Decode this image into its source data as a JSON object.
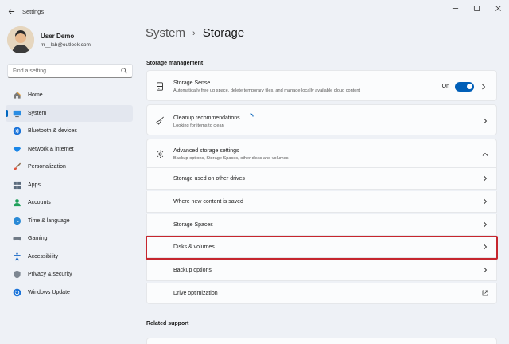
{
  "window": {
    "title": "Settings"
  },
  "user": {
    "name": "User Demo",
    "email": "m__lab@outlook.com"
  },
  "search": {
    "placeholder": "Find a setting"
  },
  "nav": {
    "items": [
      {
        "label": "Home",
        "icon": "home-icon",
        "active": false
      },
      {
        "label": "System",
        "icon": "system-icon",
        "active": true
      },
      {
        "label": "Bluetooth & devices",
        "icon": "bluetooth-icon",
        "active": false
      },
      {
        "label": "Network & internet",
        "icon": "wifi-icon",
        "active": false
      },
      {
        "label": "Personalization",
        "icon": "brush-icon",
        "active": false
      },
      {
        "label": "Apps",
        "icon": "apps-icon",
        "active": false
      },
      {
        "label": "Accounts",
        "icon": "accounts-icon",
        "active": false
      },
      {
        "label": "Time & language",
        "icon": "globe-clock-icon",
        "active": false
      },
      {
        "label": "Gaming",
        "icon": "gamepad-icon",
        "active": false
      },
      {
        "label": "Accessibility",
        "icon": "accessibility-icon",
        "active": false
      },
      {
        "label": "Privacy & security",
        "icon": "shield-icon",
        "active": false
      },
      {
        "label": "Windows Update",
        "icon": "update-icon",
        "active": false
      }
    ]
  },
  "breadcrumb": {
    "parent": "System",
    "separator": "›",
    "current": "Storage"
  },
  "storage_management": {
    "heading": "Storage management",
    "storage_sense": {
      "title": "Storage Sense",
      "description": "Automatically free up space, delete temporary files, and manage locally available cloud content",
      "toggle_label": "On",
      "toggle_on": true
    },
    "cleanup": {
      "title": "Cleanup recommendations",
      "description": "Looking for items to clean"
    },
    "advanced": {
      "title": "Advanced storage settings",
      "description": "Backup options, Storage Spaces, other disks and volumes",
      "expanded": true,
      "items": [
        {
          "label": "Storage used on other drives",
          "icon": "chevron-right-icon"
        },
        {
          "label": "Where new content is saved",
          "icon": "chevron-right-icon"
        },
        {
          "label": "Storage Spaces",
          "icon": "chevron-right-icon"
        },
        {
          "label": "Disks & volumes",
          "icon": "chevron-right-icon",
          "highlighted": true
        },
        {
          "label": "Backup options",
          "icon": "chevron-right-icon"
        },
        {
          "label": "Drive optimization",
          "icon": "external-link-icon"
        }
      ]
    }
  },
  "related_support": {
    "heading": "Related support"
  },
  "colors": {
    "accent": "#005fb8",
    "highlight": "#c6262e",
    "background": "#eef1f6"
  }
}
